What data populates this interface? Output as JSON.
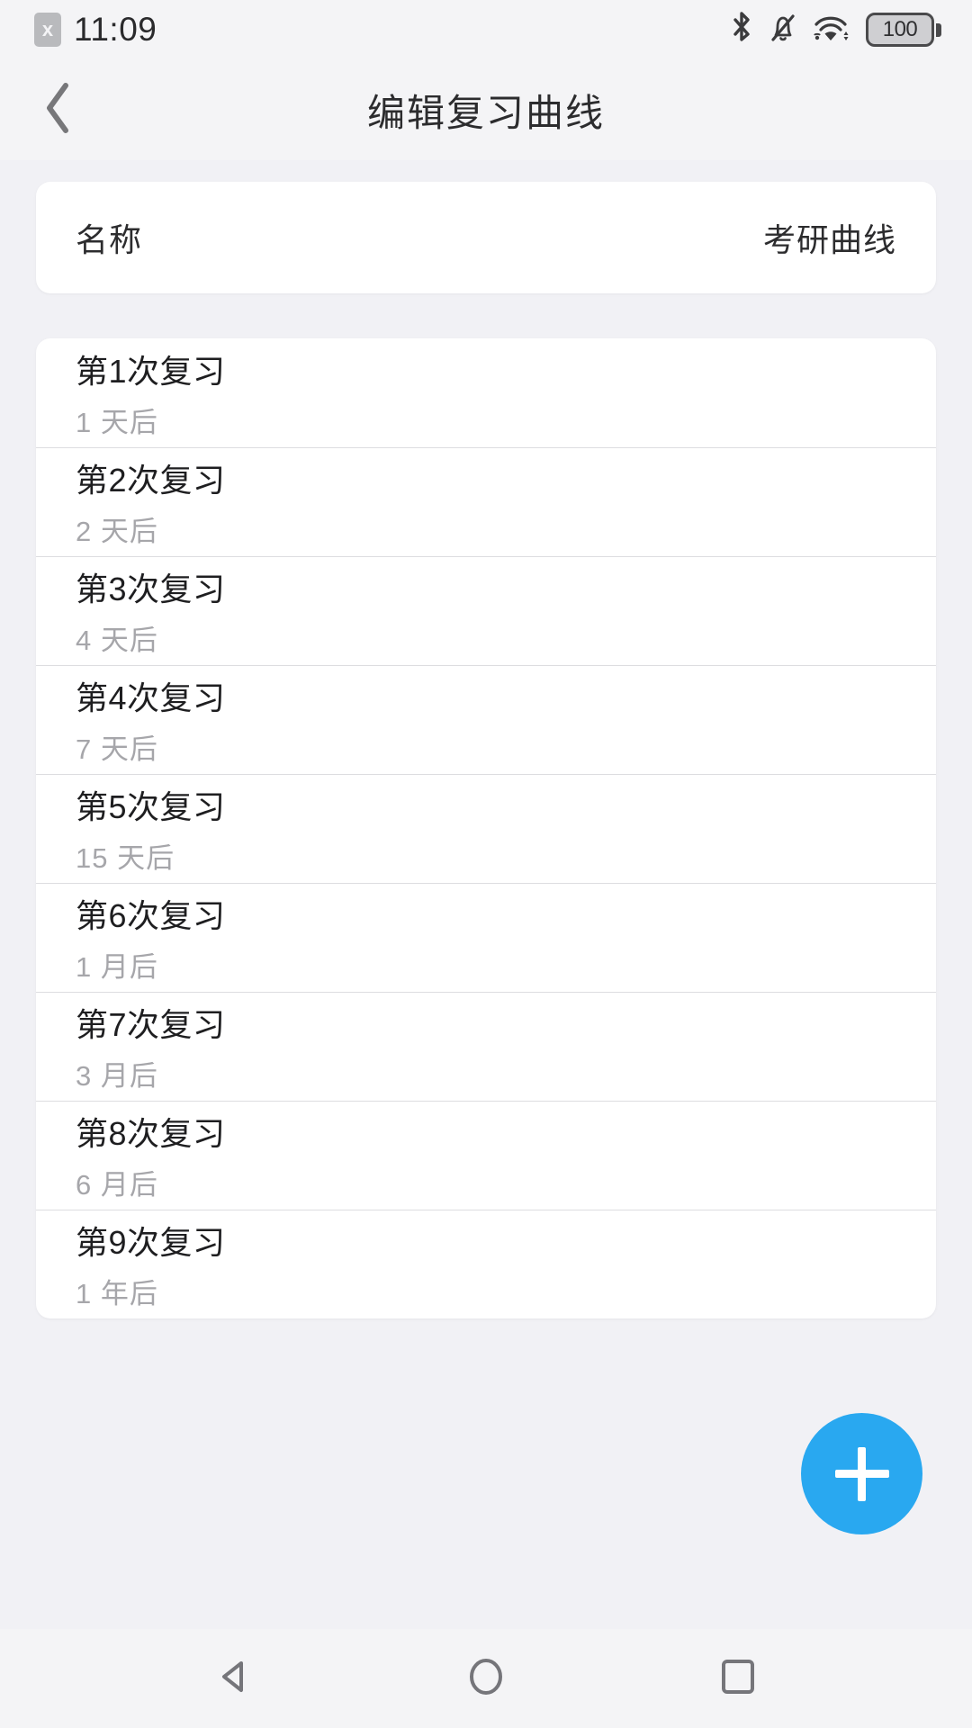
{
  "status_bar": {
    "sim_badge": "x",
    "time": "11:09",
    "icons": [
      "bluetooth-icon",
      "bell-muted-icon",
      "wifi-icon"
    ],
    "battery_level": "100"
  },
  "app_bar": {
    "back_icon": "chevron-left-icon",
    "title": "编辑复习曲线"
  },
  "name_card": {
    "label": "名称",
    "value": "考研曲线"
  },
  "review_list": [
    {
      "title": "第1次复习",
      "subtitle": "1 天后"
    },
    {
      "title": "第2次复习",
      "subtitle": "2 天后"
    },
    {
      "title": "第3次复习",
      "subtitle": "4 天后"
    },
    {
      "title": "第4次复习",
      "subtitle": "7 天后"
    },
    {
      "title": "第5次复习",
      "subtitle": "15 天后"
    },
    {
      "title": "第6次复习",
      "subtitle": "1 月后"
    },
    {
      "title": "第7次复习",
      "subtitle": "3 月后"
    },
    {
      "title": "第8次复习",
      "subtitle": "6 月后"
    },
    {
      "title": "第9次复习",
      "subtitle": "1 年后"
    }
  ],
  "fab": {
    "icon": "plus-icon",
    "color": "#29A8F0"
  },
  "nav_bar": {
    "back": "triangle-back-icon",
    "home": "circle-home-icon",
    "recents": "square-recents-icon"
  }
}
